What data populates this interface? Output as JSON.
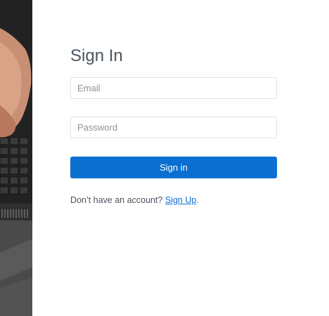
{
  "signin": {
    "title": "Sign In",
    "email_placeholder": "Email",
    "password_placeholder": "Password",
    "button_label": "Sign in",
    "prompt_text": "Don’t have an account?",
    "signup_link": "Sign Up",
    "prompt_suffix": "."
  },
  "colors": {
    "accent": "#0a6fd1",
    "title_text": "#4a5560",
    "input_border": "#dfe3e6"
  },
  "icons": {
    "background_photo": "hands-on-laptop-keyboard"
  }
}
